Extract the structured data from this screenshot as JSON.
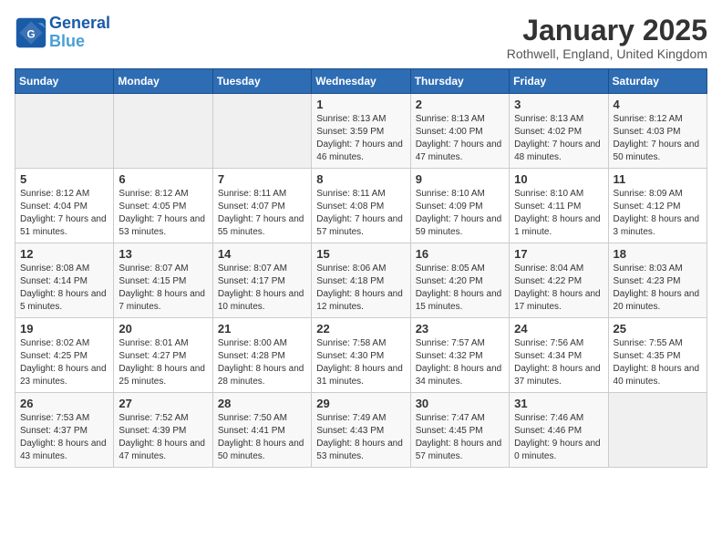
{
  "header": {
    "logo_line1": "General",
    "logo_line2": "Blue",
    "month": "January 2025",
    "location": "Rothwell, England, United Kingdom"
  },
  "days_of_week": [
    "Sunday",
    "Monday",
    "Tuesday",
    "Wednesday",
    "Thursday",
    "Friday",
    "Saturday"
  ],
  "weeks": [
    [
      {
        "day": "",
        "info": ""
      },
      {
        "day": "",
        "info": ""
      },
      {
        "day": "",
        "info": ""
      },
      {
        "day": "1",
        "info": "Sunrise: 8:13 AM\nSunset: 3:59 PM\nDaylight: 7 hours and 46 minutes."
      },
      {
        "day": "2",
        "info": "Sunrise: 8:13 AM\nSunset: 4:00 PM\nDaylight: 7 hours and 47 minutes."
      },
      {
        "day": "3",
        "info": "Sunrise: 8:13 AM\nSunset: 4:02 PM\nDaylight: 7 hours and 48 minutes."
      },
      {
        "day": "4",
        "info": "Sunrise: 8:12 AM\nSunset: 4:03 PM\nDaylight: 7 hours and 50 minutes."
      }
    ],
    [
      {
        "day": "5",
        "info": "Sunrise: 8:12 AM\nSunset: 4:04 PM\nDaylight: 7 hours and 51 minutes."
      },
      {
        "day": "6",
        "info": "Sunrise: 8:12 AM\nSunset: 4:05 PM\nDaylight: 7 hours and 53 minutes."
      },
      {
        "day": "7",
        "info": "Sunrise: 8:11 AM\nSunset: 4:07 PM\nDaylight: 7 hours and 55 minutes."
      },
      {
        "day": "8",
        "info": "Sunrise: 8:11 AM\nSunset: 4:08 PM\nDaylight: 7 hours and 57 minutes."
      },
      {
        "day": "9",
        "info": "Sunrise: 8:10 AM\nSunset: 4:09 PM\nDaylight: 7 hours and 59 minutes."
      },
      {
        "day": "10",
        "info": "Sunrise: 8:10 AM\nSunset: 4:11 PM\nDaylight: 8 hours and 1 minute."
      },
      {
        "day": "11",
        "info": "Sunrise: 8:09 AM\nSunset: 4:12 PM\nDaylight: 8 hours and 3 minutes."
      }
    ],
    [
      {
        "day": "12",
        "info": "Sunrise: 8:08 AM\nSunset: 4:14 PM\nDaylight: 8 hours and 5 minutes."
      },
      {
        "day": "13",
        "info": "Sunrise: 8:07 AM\nSunset: 4:15 PM\nDaylight: 8 hours and 7 minutes."
      },
      {
        "day": "14",
        "info": "Sunrise: 8:07 AM\nSunset: 4:17 PM\nDaylight: 8 hours and 10 minutes."
      },
      {
        "day": "15",
        "info": "Sunrise: 8:06 AM\nSunset: 4:18 PM\nDaylight: 8 hours and 12 minutes."
      },
      {
        "day": "16",
        "info": "Sunrise: 8:05 AM\nSunset: 4:20 PM\nDaylight: 8 hours and 15 minutes."
      },
      {
        "day": "17",
        "info": "Sunrise: 8:04 AM\nSunset: 4:22 PM\nDaylight: 8 hours and 17 minutes."
      },
      {
        "day": "18",
        "info": "Sunrise: 8:03 AM\nSunset: 4:23 PM\nDaylight: 8 hours and 20 minutes."
      }
    ],
    [
      {
        "day": "19",
        "info": "Sunrise: 8:02 AM\nSunset: 4:25 PM\nDaylight: 8 hours and 23 minutes."
      },
      {
        "day": "20",
        "info": "Sunrise: 8:01 AM\nSunset: 4:27 PM\nDaylight: 8 hours and 25 minutes."
      },
      {
        "day": "21",
        "info": "Sunrise: 8:00 AM\nSunset: 4:28 PM\nDaylight: 8 hours and 28 minutes."
      },
      {
        "day": "22",
        "info": "Sunrise: 7:58 AM\nSunset: 4:30 PM\nDaylight: 8 hours and 31 minutes."
      },
      {
        "day": "23",
        "info": "Sunrise: 7:57 AM\nSunset: 4:32 PM\nDaylight: 8 hours and 34 minutes."
      },
      {
        "day": "24",
        "info": "Sunrise: 7:56 AM\nSunset: 4:34 PM\nDaylight: 8 hours and 37 minutes."
      },
      {
        "day": "25",
        "info": "Sunrise: 7:55 AM\nSunset: 4:35 PM\nDaylight: 8 hours and 40 minutes."
      }
    ],
    [
      {
        "day": "26",
        "info": "Sunrise: 7:53 AM\nSunset: 4:37 PM\nDaylight: 8 hours and 43 minutes."
      },
      {
        "day": "27",
        "info": "Sunrise: 7:52 AM\nSunset: 4:39 PM\nDaylight: 8 hours and 47 minutes."
      },
      {
        "day": "28",
        "info": "Sunrise: 7:50 AM\nSunset: 4:41 PM\nDaylight: 8 hours and 50 minutes."
      },
      {
        "day": "29",
        "info": "Sunrise: 7:49 AM\nSunset: 4:43 PM\nDaylight: 8 hours and 53 minutes."
      },
      {
        "day": "30",
        "info": "Sunrise: 7:47 AM\nSunset: 4:45 PM\nDaylight: 8 hours and 57 minutes."
      },
      {
        "day": "31",
        "info": "Sunrise: 7:46 AM\nSunset: 4:46 PM\nDaylight: 9 hours and 0 minutes."
      },
      {
        "day": "",
        "info": ""
      }
    ]
  ]
}
